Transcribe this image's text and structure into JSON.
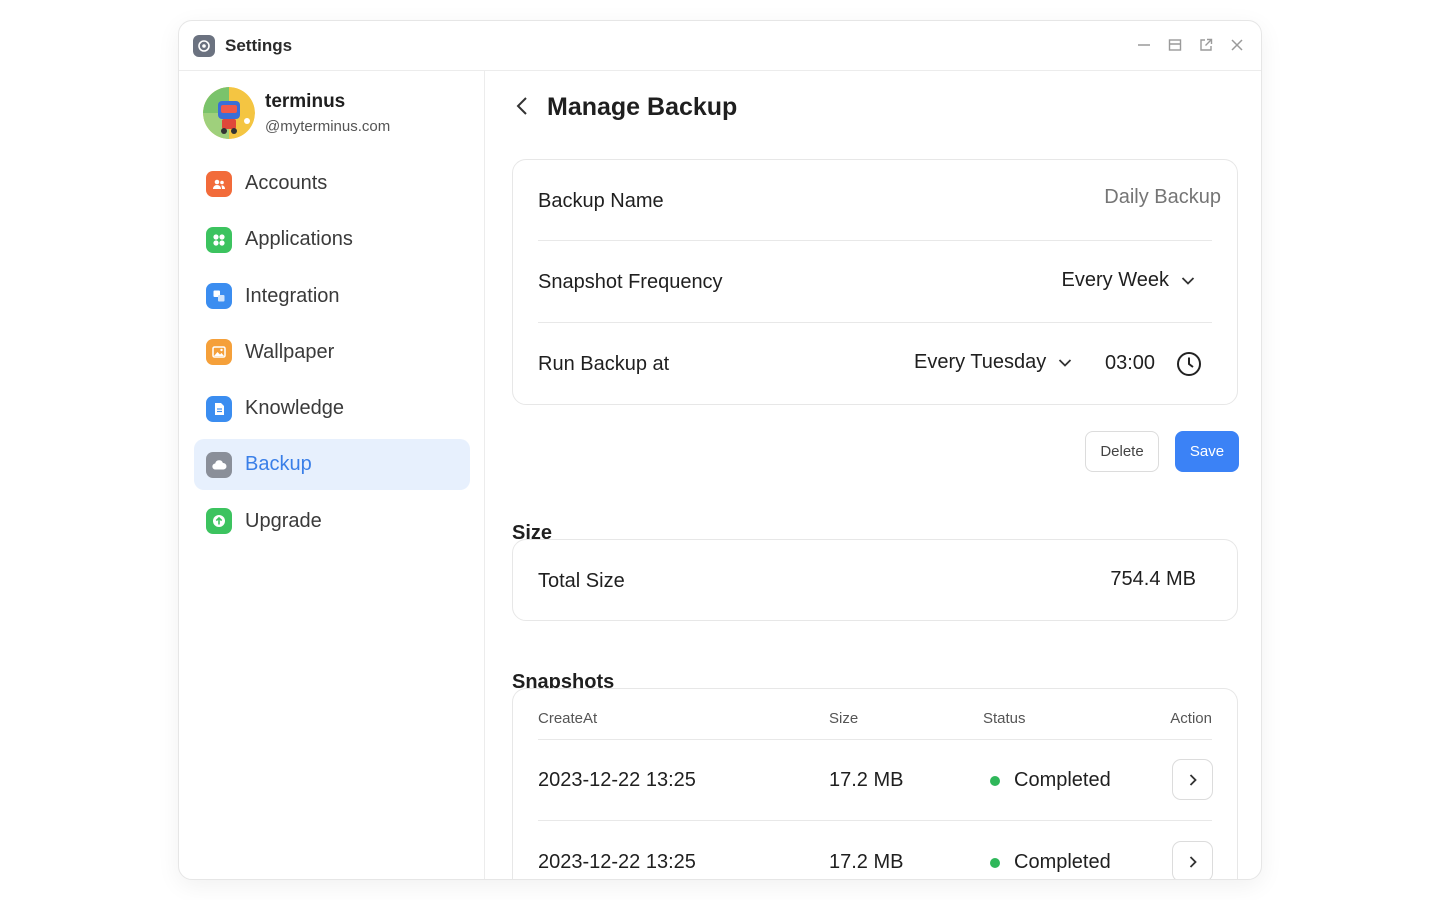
{
  "window": {
    "title": "Settings"
  },
  "profile": {
    "name": "terminus",
    "domain": "@myterminus.com"
  },
  "sidebar": {
    "items": [
      {
        "label": "Accounts",
        "icon": "accounts-icon",
        "color": "#f26b3a"
      },
      {
        "label": "Applications",
        "icon": "applications-icon",
        "color": "#3cc35f"
      },
      {
        "label": "Integration",
        "icon": "integration-icon",
        "color": "#3b8df0"
      },
      {
        "label": "Wallpaper",
        "icon": "wallpaper-icon",
        "color": "#f5a03a"
      },
      {
        "label": "Knowledge",
        "icon": "knowledge-icon",
        "color": "#3b8df0"
      },
      {
        "label": "Backup",
        "icon": "backup-icon",
        "color": "#8a8f99",
        "active": true
      },
      {
        "label": "Upgrade",
        "icon": "upgrade-icon",
        "color": "#3cc35f"
      }
    ]
  },
  "main": {
    "title": "Manage Backup",
    "backup_name": {
      "label": "Backup Name",
      "placeholder": "Daily Backup"
    },
    "snapshot_frequency": {
      "label": "Snapshot Frequency",
      "value": "Every Week"
    },
    "run_backup": {
      "label": "Run Backup at",
      "day": "Every Tuesday",
      "time": "03:00"
    },
    "buttons": {
      "delete": "Delete",
      "save": "Save"
    },
    "size_section": {
      "title": "Size",
      "label": "Total Size",
      "value": "754.4 MB"
    },
    "snapshots_section": {
      "title": "Snapshots",
      "columns": [
        "CreateAt",
        "Size",
        "Status",
        "Action"
      ],
      "rows": [
        {
          "created_at": "2023-12-22 13:25",
          "size": "17.2 MB",
          "status": "Completed"
        },
        {
          "created_at": "2023-12-22 13:25",
          "size": "17.2 MB",
          "status": "Completed"
        }
      ]
    }
  },
  "colors": {
    "accent": "#3b82f6",
    "active_bg": "#e7f0fd",
    "status_completed": "#2fb75a"
  }
}
